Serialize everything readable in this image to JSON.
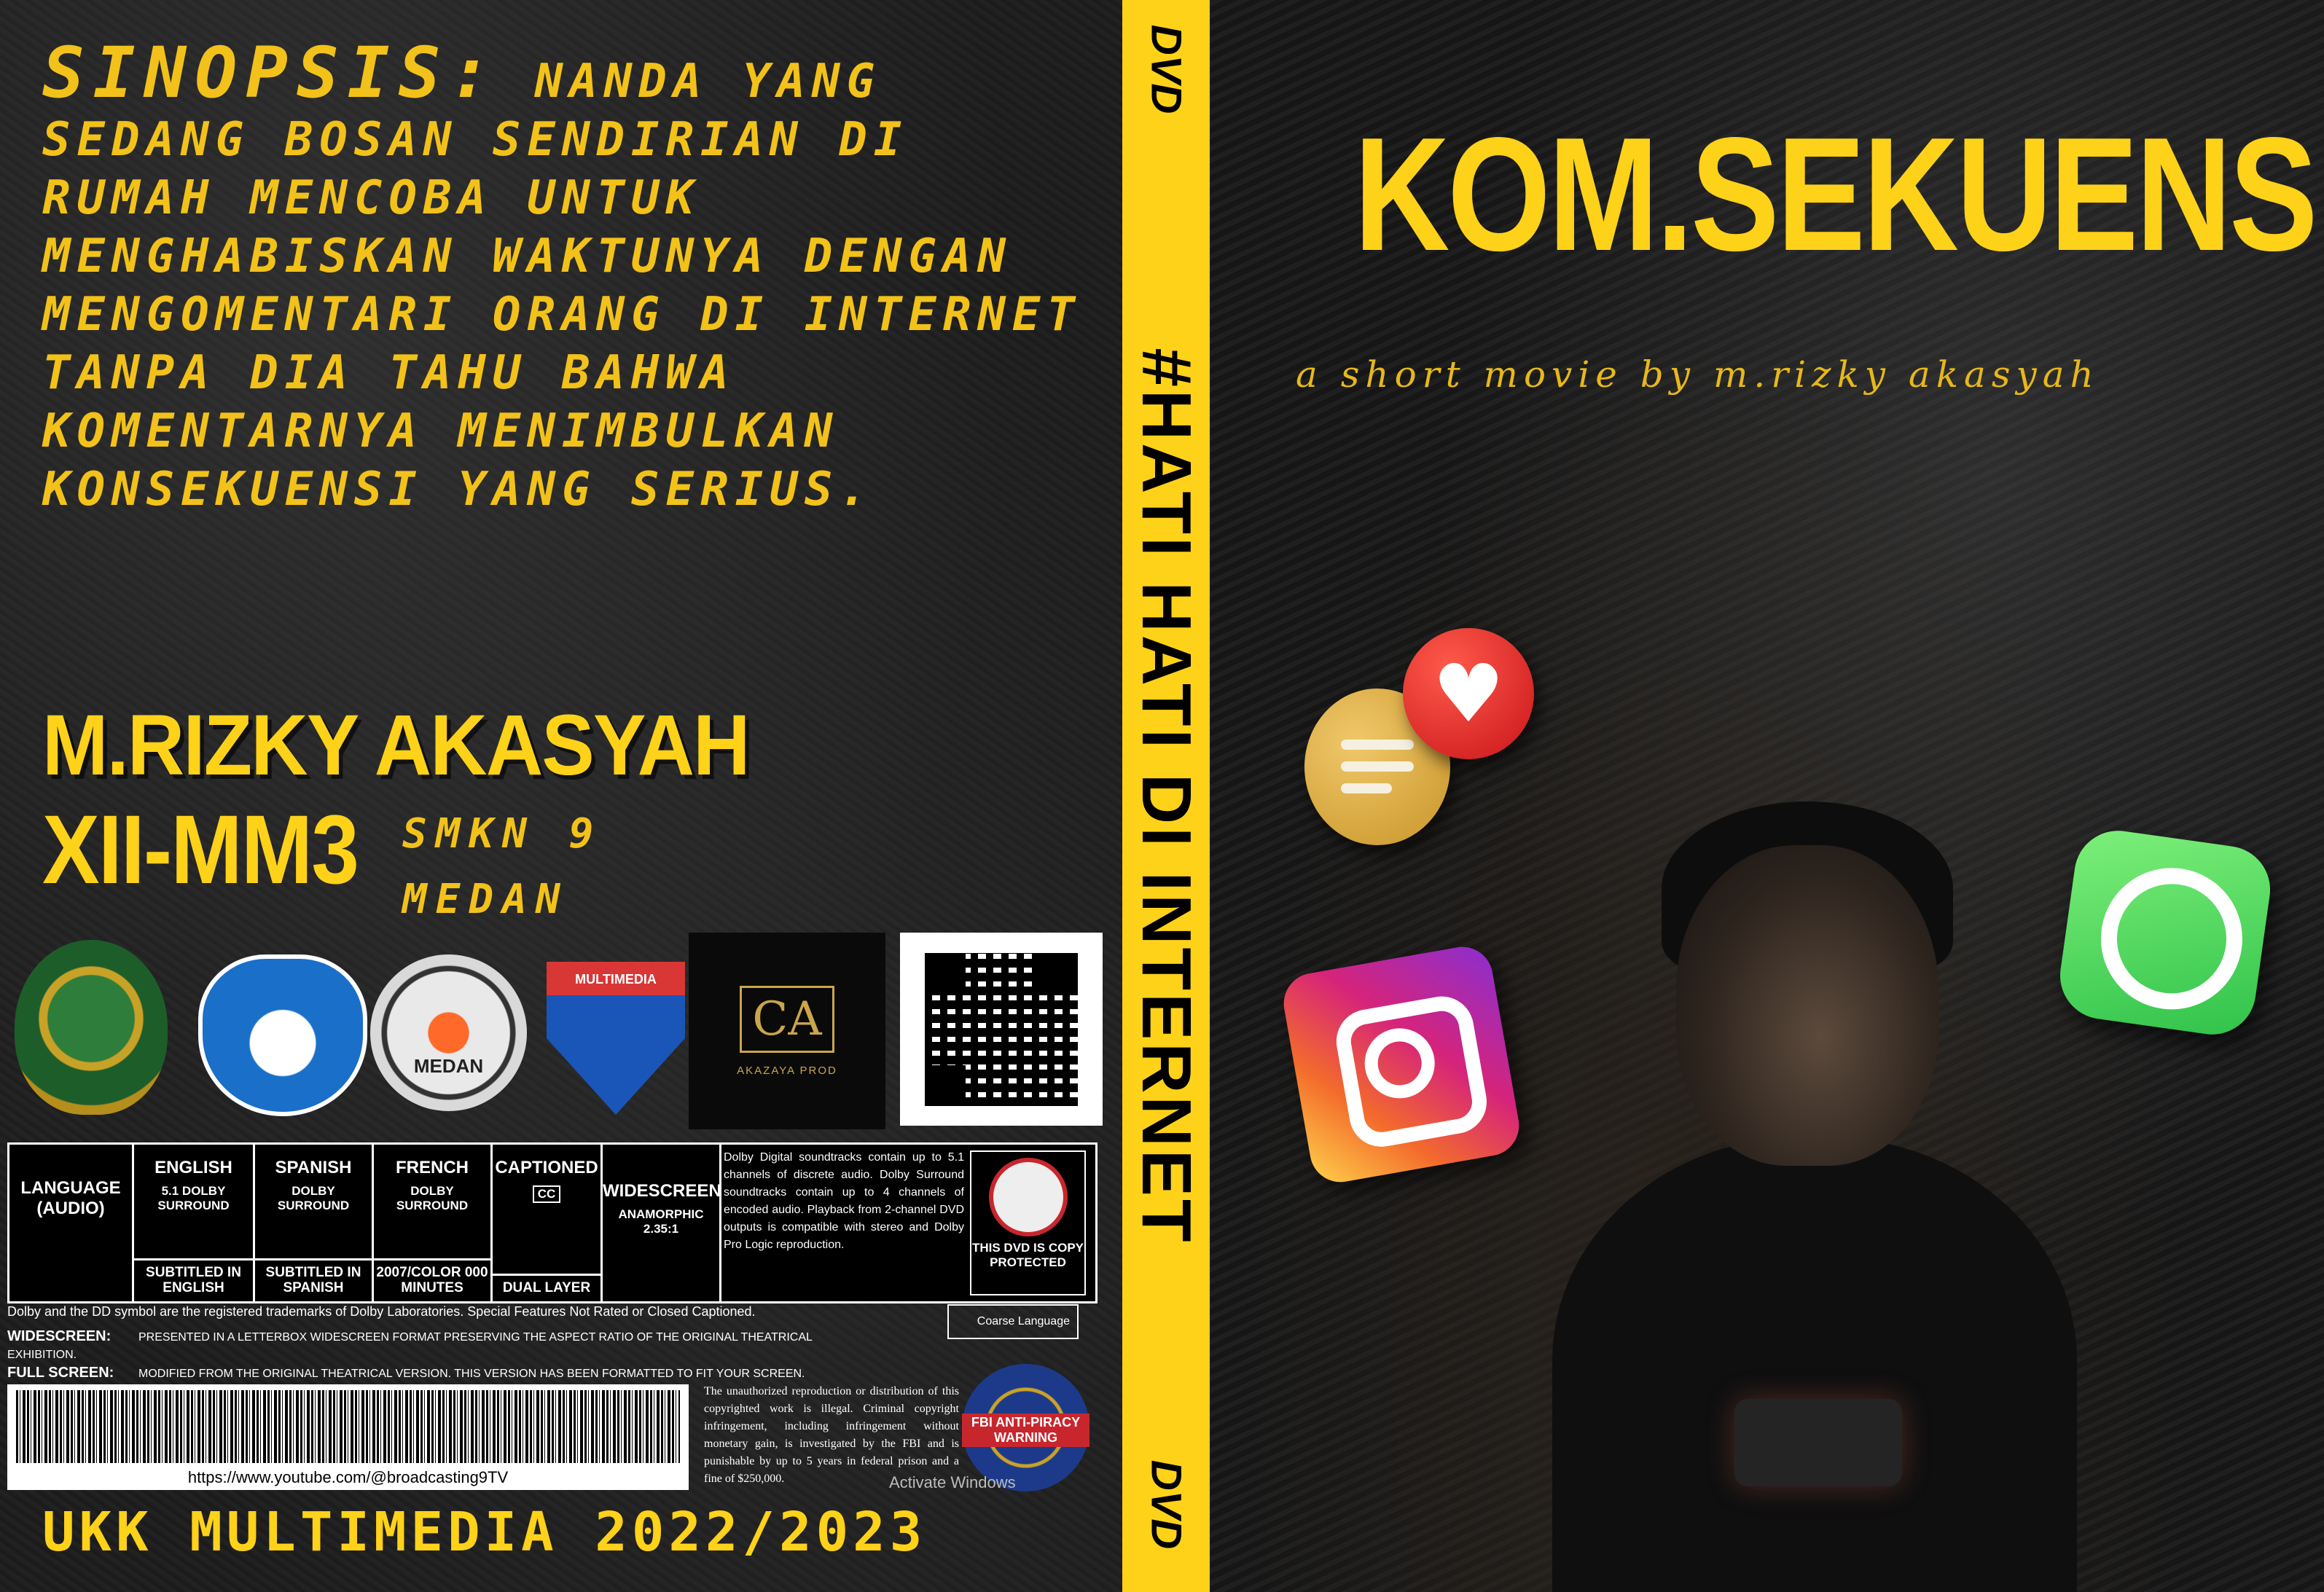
{
  "back": {
    "synopsis_head": "SINOPSIS:",
    "synopsis_body": "NANDA YANG SEDANG BOSAN SENDIRIAN DI RUMAH MENCOBA UNTUK MENGHABISKAN WAKTUNYA DENGAN   MENGOMENTARI ORANG DI INTERNET TANPA DIA TAHU BAHWA KOMENTARNYA MENIMBULKAN KONSEKUENSI YANG SERIUS.",
    "author": "M.RIZKY AKASYAH",
    "class": "XII-MM3",
    "school_line1": "SMKN 9",
    "school_line2": "MEDAN",
    "logo_c_text": "MEDAN",
    "logo_d_text": "MULTIMEDIA",
    "logo_e_monogram": "CA",
    "logo_e_caption": "AKAZAYA PROD",
    "spec": {
      "language_label": "LANGUAGE (AUDIO)",
      "english": "ENGLISH",
      "english_sub": "5.1 DOLBY SURROUND",
      "english_bottom": "SUBTITLED IN ENGLISH",
      "spanish": "SPANISH",
      "spanish_sub": "DOLBY SURROUND",
      "spanish_bottom": "SUBTITLED IN SPANISH",
      "french": "FRENCH",
      "french_sub": "DOLBY SURROUND",
      "french_bottom": "2007/COLOR 000 MINUTES",
      "captioned": "CAPTIONED",
      "cc": "CC",
      "captioned_bottom": "DUAL LAYER",
      "widescreen": "WIDESCREEN",
      "widescreen_sub": "ANAMORPHIC 2.35:1",
      "dolby_text": "Dolby Digital soundtracks contain up to 5.1 channels of discrete audio. Dolby Surround soundtracks contain up to 4 channels of encoded audio. Playback from 2-channel DVD outputs is compatible with stereo and Dolby Pro Logic reproduction.",
      "copy_protected": "THIS DVD IS COPY PROTECTED"
    },
    "trademark_line": "Dolby and the DD symbol are the registered trademarks of Dolby Laboratories. Special Features Not Rated or Closed Captioned.",
    "widescreen_label": "WIDESCREEN:",
    "widescreen_note": "PRESENTED IN A LETTERBOX WIDESCREEN FORMAT PRESERVING THE ASPECT RATIO OF THE ORIGINAL THEATRICAL EXHIBITION.",
    "fullscreen_label": "FULL SCREEN:",
    "fullscreen_note": "MODIFIED FROM THE ORIGINAL THEATRICAL VERSION. THIS VERSION HAS BEEN FORMATTED TO FIT YOUR SCREEN.",
    "rating": "Coarse Language",
    "barcode_url": "https://www.youtube.com/@broadcasting9TV",
    "legal": "The unauthorized reproduction or distribution of this copyrighted work is illegal. Criminal copyright infringement, including infringement without monetary gain, is investigated by the FBI and is punishable by up to 5 years in federal prison and a fine of $250,000.",
    "fbi": "FBI ANTI-PIRACY WARNING",
    "activate": "Activate Windows",
    "ukk": "UKK MULTIMEDIA 2022/2023"
  },
  "spine": {
    "title": "#HATI HATI DI INTERNET",
    "dvd": "DVD"
  },
  "front": {
    "title": "KOM.SEKUENS.",
    "tagline": "a short movie by m.rizky akasyah"
  },
  "colors": {
    "accent": "#ffd21a",
    "background": "#1b1b1b"
  },
  "icons": [
    "instagram-icon",
    "whatsapp-icon",
    "chat-bubble-icon",
    "heart-bubble-icon",
    "qr-code-icon"
  ]
}
